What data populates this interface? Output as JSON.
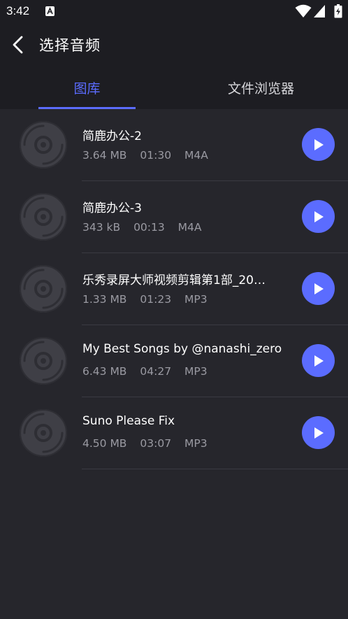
{
  "status_bar": {
    "time": "3:42"
  },
  "app_bar": {
    "title": "选择音频",
    "back_icon": "chevron-left-icon"
  },
  "tabs": [
    {
      "label": "图库",
      "selected": true
    },
    {
      "label": "文件浏览器",
      "selected": false
    }
  ],
  "colors": {
    "accent": "#5b6cff",
    "background": "#26262c",
    "header": "#1d1d22",
    "secondary_text": "#9a9aa2"
  },
  "audio_items": [
    {
      "name": "简鹿办公-2",
      "size": "3.64 MB",
      "duration": "01:30",
      "format": "M4A"
    },
    {
      "name": "简鹿办公-3",
      "size": "343 kB",
      "duration": "00:13",
      "format": "M4A"
    },
    {
      "name": "乐秀录屏大师视频剪辑第1部_20…",
      "size": "1.33 MB",
      "duration": "01:23",
      "format": "MP3"
    },
    {
      "name": "My Best Songs by @nanashi_zero",
      "size": "6.43 MB",
      "duration": "04:27",
      "format": "MP3"
    },
    {
      "name": "Suno Please Fix",
      "size": "4.50 MB",
      "duration": "03:07",
      "format": "MP3"
    }
  ]
}
